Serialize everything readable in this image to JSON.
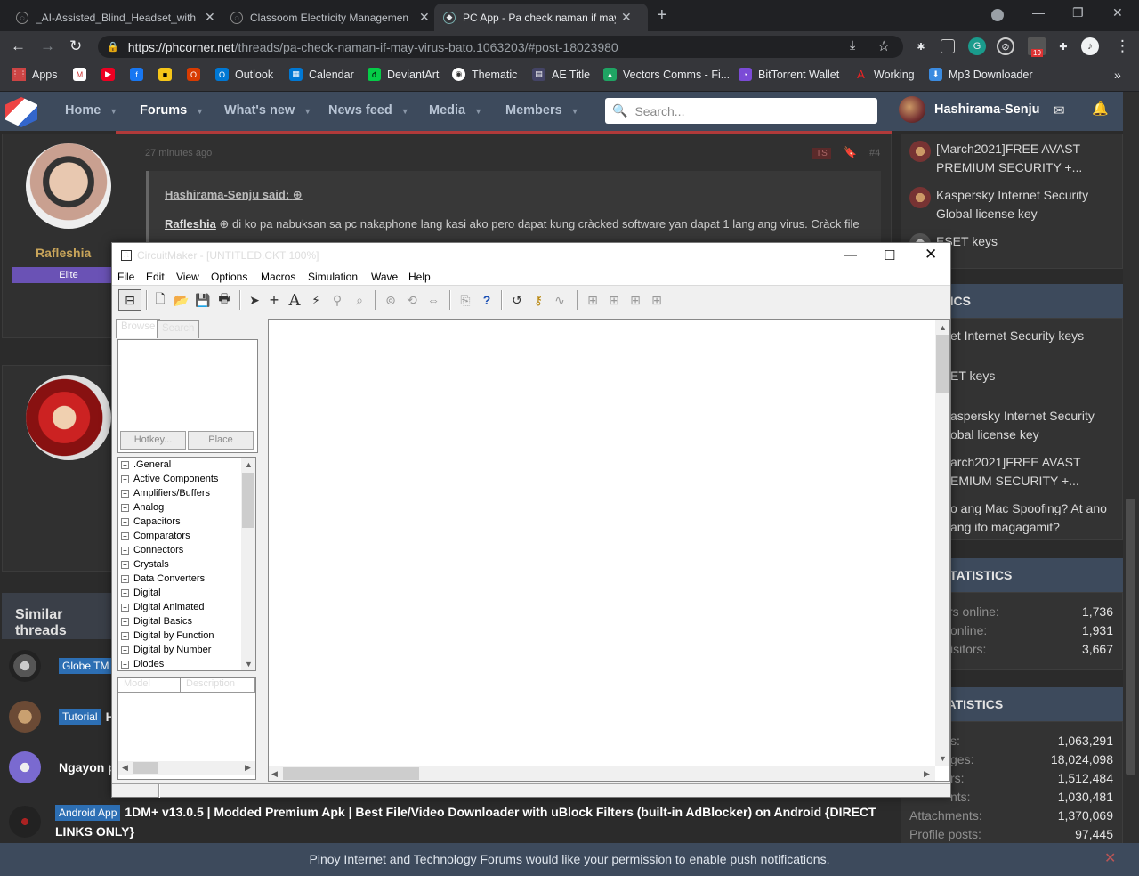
{
  "browser": {
    "tabs": [
      {
        "title": "_AI-Assisted_Blind_Headset_with",
        "active": false
      },
      {
        "title": "Classoom Electricity Managemen",
        "active": false
      },
      {
        "title": "PC App - Pa check naman if may",
        "active": true
      }
    ],
    "url": "https://phcorner.net/threads/pa-check-naman-if-may-virus-bato.1063203/#post-18023980",
    "url_host": "https://phcorner.net",
    "url_path": "/threads/pa-check-naman-if-may-virus-bato.1063203/#post-18023980",
    "ext_badge": "19",
    "bookmarks": [
      "Apps",
      "Outlook",
      "Calendar",
      "DeviantArt",
      "Thematic",
      "AE Title",
      "Vectors Comms - Fi...",
      "BitTorrent Wallet",
      "Working",
      "Mp3 Downloader"
    ],
    "more": "»"
  },
  "site": {
    "nav": [
      {
        "label": "Home",
        "selected": false
      },
      {
        "label": "Forums",
        "selected": true
      },
      {
        "label": "What's new",
        "selected": false
      },
      {
        "label": "News feed",
        "selected": false
      },
      {
        "label": "Media",
        "selected": false
      },
      {
        "label": "Members",
        "selected": false
      }
    ],
    "search_placeholder": "Search...",
    "username": "Hashirama-Senju"
  },
  "post": {
    "author": "Rafleshia",
    "badge": "Elite",
    "time": "27 minutes ago",
    "ts": "TS",
    "number": "#4",
    "quote_author": "Hashirama-Senju said:",
    "quote_user": "Rafleshia",
    "quote_text": "di ko pa nabuksan sa pc nakaphone lang kasi ako pero dapat kung cràcked software yan dapat 1 lang ang virus. Cràck file"
  },
  "similar": {
    "heading": "Similar threads",
    "rows": [
      {
        "tag": "Globe TM",
        "title": ""
      },
      {
        "tag": "Tutorial",
        "title": "H"
      },
      {
        "tag": "",
        "title": "Ngayon p"
      }
    ],
    "last_tag": "Android App",
    "last_title": "1DM+ v13.0.5 | Modded Premium Apk | Best File/Video Downloader with uBlock Filters (built-in AdBlocker) on Android {DIRECT LINKS ONLY}"
  },
  "sidebar": {
    "top_links": [
      "[March2021]FREE AVAST PREMIUM SECURITY +...",
      "Kaspersky Internet Security Global license key",
      "ESET keys"
    ],
    "topics_head": "W TOPICS",
    "topics": [
      "et Internet Security keys",
      "ET keys",
      "aspersky Internet Security obal license key",
      "arch2021]FREE AVAST EMIUM SECURITY +...",
      "o ang Mac Spoofing? At ano ang ito magagamit?"
    ],
    "online_head": "LINE STATISTICS",
    "online": [
      {
        "k": "rs online:",
        "v": "1,736"
      },
      {
        "k": "online:",
        "v": "1,931"
      },
      {
        "k": "isitors:",
        "v": "3,667"
      }
    ],
    "forum_head": "UM STATISTICS",
    "forum": [
      {
        "k": "s:",
        "v": "1,063,291"
      },
      {
        "k": "ges:",
        "v": "18,024,098"
      },
      {
        "k": "rs:",
        "v": "1,512,484"
      },
      {
        "k": "nts:",
        "v": "1,030,481"
      },
      {
        "k": "Attachments:",
        "v": "1,370,069"
      },
      {
        "k": "Profile posts:",
        "v": "97,445"
      }
    ]
  },
  "push": "Pinoy Internet and Technology Forums would like your permission to enable push notifications.",
  "circuitmaker": {
    "title": "CircuitMaker - [UNTITLED.CKT 100%]",
    "menu": [
      "File",
      "Edit",
      "View",
      "Options",
      "Macros",
      "Simulation",
      "Wave",
      "Help"
    ],
    "tabs": [
      "Browse",
      "Search"
    ],
    "hotkey": "Hotkey...",
    "place": "Place",
    "tree": [
      ".General",
      "Active Components",
      "Amplifiers/Buffers",
      "Analog",
      "Capacitors",
      "Comparators",
      "Connectors",
      "Crystals",
      "Data Converters",
      "Digital",
      "Digital Animated",
      "Digital Basics",
      "Digital by Function",
      "Digital by Number",
      "Diodes"
    ],
    "cols": [
      "Model",
      "Description"
    ]
  }
}
